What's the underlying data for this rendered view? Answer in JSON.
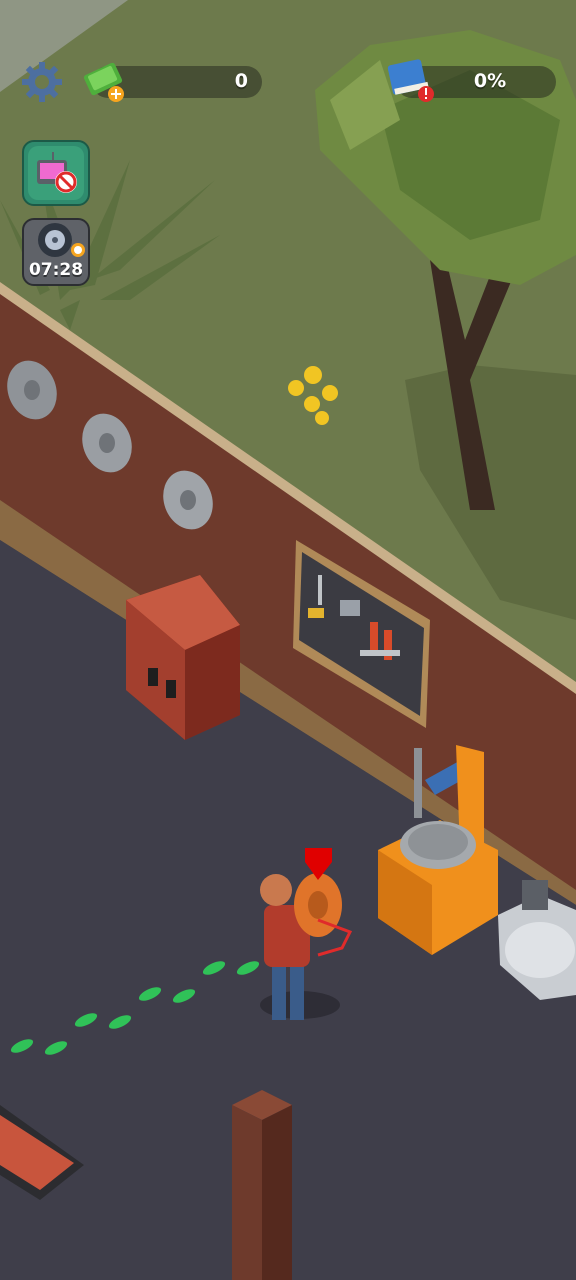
{
  "hud": {
    "cash_value": "0",
    "progress_value": "0%",
    "timer_value": "07:28"
  },
  "icons": {
    "settings": "gear-icon",
    "cash": "cash-plus-icon",
    "manual": "manual-book-alert-icon",
    "no_ads": "no-ads-tv-icon",
    "tire_timer": "tire-timer-icon"
  },
  "colors": {
    "grass": "#6d7a4c",
    "wall_brick": "#6e3a2c",
    "floor": "#3f3e4a",
    "no_ads_button": "#3aa07a",
    "footprints": "#2fd15a",
    "machine_orange": "#f0901c"
  }
}
